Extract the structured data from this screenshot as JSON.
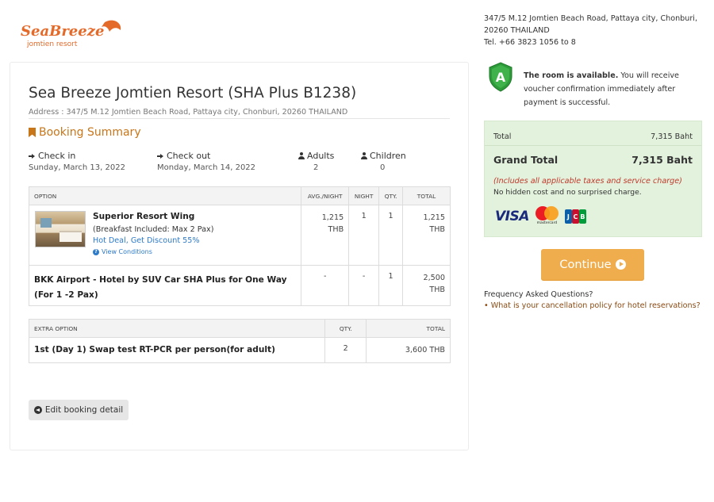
{
  "logo": {
    "line1": "SeaBreeze",
    "line2": "jomtien resort"
  },
  "hotel_info": {
    "line1": "347/5 M.12 Jomtien Beach Road, Pattaya city, Chonburi,",
    "line2": "20260 THAILAND",
    "line3": "Tel. +66 3823 1056 to 8"
  },
  "main": {
    "title": "Sea Breeze Jomtien Resort (SHA Plus B1238)",
    "address": "Address : 347/5 M.12 Jomtien Beach Road, Pattaya city, Chonburi, 20260 THAILAND",
    "summary_heading": "Booking Summary",
    "checkin_label": "Check in",
    "checkin_value": "Sunday, March 13, 2022",
    "checkout_label": "Check out",
    "checkout_value": "Monday, March 14, 2022",
    "adults_label": "Adults",
    "adults_value": "2",
    "children_label": "Children",
    "children_value": "0"
  },
  "options_table": {
    "headers": {
      "option": "OPTION",
      "avg": "AVG./NIGHT",
      "night": "NIGHT",
      "qty": "QTY.",
      "total": "TOTAL"
    },
    "room": {
      "name": "Superior Resort Wing",
      "sub": "(Breakfast Included: Max 2 Pax)",
      "deal": "Hot Deal, Get Discount 55%",
      "conditions": "View Conditions",
      "avg_amount": "1,215",
      "avg_currency": "THB",
      "night": "1",
      "qty": "1",
      "total_amount": "1,215",
      "total_currency": "THB"
    },
    "transfer": {
      "name": "BKK Airport - Hotel by SUV Car SHA Plus for One Way (For 1 -2 Pax)",
      "avg": "-",
      "night": "-",
      "qty": "1",
      "total_amount": "2,500",
      "total_currency": "THB"
    }
  },
  "extra_table": {
    "headers": {
      "option": "EXTRA OPTION",
      "qty": "QTY.",
      "total": "TOTAL"
    },
    "rows": [
      {
        "name": "1st (Day 1) Swap test RT-PCR per person(for adult)",
        "qty": "2",
        "total": "3,600 THB"
      }
    ]
  },
  "edit_button": "Edit booking detail",
  "availability": {
    "bold": "The room is available.",
    "rest": " You will receive voucher confirmation immediately after payment is successful.",
    "shield_letter": "A"
  },
  "price_box": {
    "total_label": "Total",
    "total_value": "7,315 Baht",
    "grand_label": "Grand Total",
    "grand_value": "7,315 Baht",
    "includes": "(Includes all applicable taxes and service charge)",
    "hidden": "No hidden cost and no surprised charge.",
    "cards": {
      "visa": "VISA",
      "mastercard": "mastercard",
      "jcb": [
        "J",
        "C",
        "B"
      ]
    }
  },
  "continue_button": "Continue",
  "faq": {
    "title": "Frequency Asked Questions?",
    "item": "• What is your cancellation policy for hotel reservations?"
  },
  "colors": {
    "accent": "#c7761a",
    "button": "#f0ad4e",
    "link": "#2d7ac8",
    "price_bg": "#e3f2dd",
    "warning": "#c0392b"
  }
}
